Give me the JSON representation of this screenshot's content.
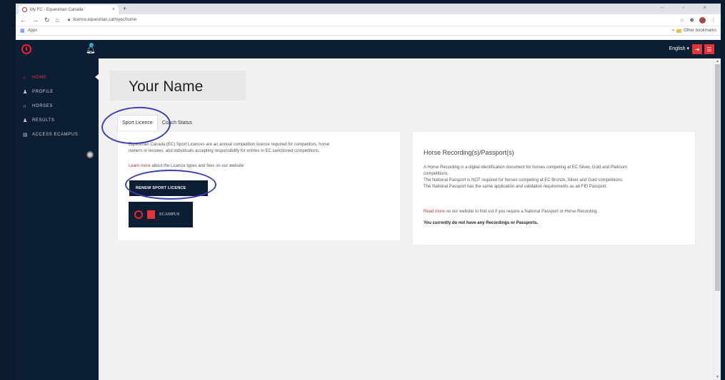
{
  "browser": {
    "tab_title": "My FC - Equestrian Canada",
    "tab_close": "×",
    "new_tab": "+",
    "window_controls": "– ▫ ×",
    "url": "licence.equestrian.ca/myec/home",
    "bookmarks_apps": "Apps",
    "other_bookmarks": "Other bookmarks"
  },
  "appbar": {
    "language": "English ▾"
  },
  "sidebar": {
    "items": [
      {
        "label": "Home",
        "icon": "home-icon",
        "glyph": "⌂"
      },
      {
        "label": "Profile",
        "icon": "user-icon",
        "glyph": "♟"
      },
      {
        "label": "Horses",
        "icon": "horseshoe-icon",
        "glyph": "∩"
      },
      {
        "label": "Results",
        "icon": "results-icon",
        "glyph": "♟"
      },
      {
        "label": "Access ECampus",
        "icon": "book-icon",
        "glyph": "▤"
      }
    ]
  },
  "main": {
    "user_name": "Your Name",
    "tabs": [
      {
        "label": "Sport Licence"
      },
      {
        "label": "Coach Status"
      }
    ],
    "sport_licence_card": {
      "intro_line1": "Equestrian Canada (EC) Sport Licences are an annual competition licence required for competitors, horse",
      "intro_line2": "owners or lessees, and individuals accepting responsibility for entries in EC sanctioned competitions.",
      "learn_more_link": "Learn more",
      "learn_more_rest": " about the Licence types and fees on our website",
      "renew_button": "RENEW SPORT LICENCE",
      "ecampus_label": "ECAMPUS"
    },
    "horse_card": {
      "title": "Horse Recording(s)/Passport(s)",
      "line1": "A Horse Recording is a digital identification document for horses competing at EC Silver, Gold and Platinum",
      "line2": "competitions.",
      "line3": "The National Passport is NOT required for horses competing at EC Bronze, Silver and Gold competitions.",
      "line4": "The National Passport has the same application and validation requirements as an FEI Passport.",
      "read_more_link": "Read more",
      "read_more_rest": " on our website to find out if you require a National Passport or Horse Recording.",
      "no_records": "You currently do not have any Recordings or Passports."
    }
  }
}
